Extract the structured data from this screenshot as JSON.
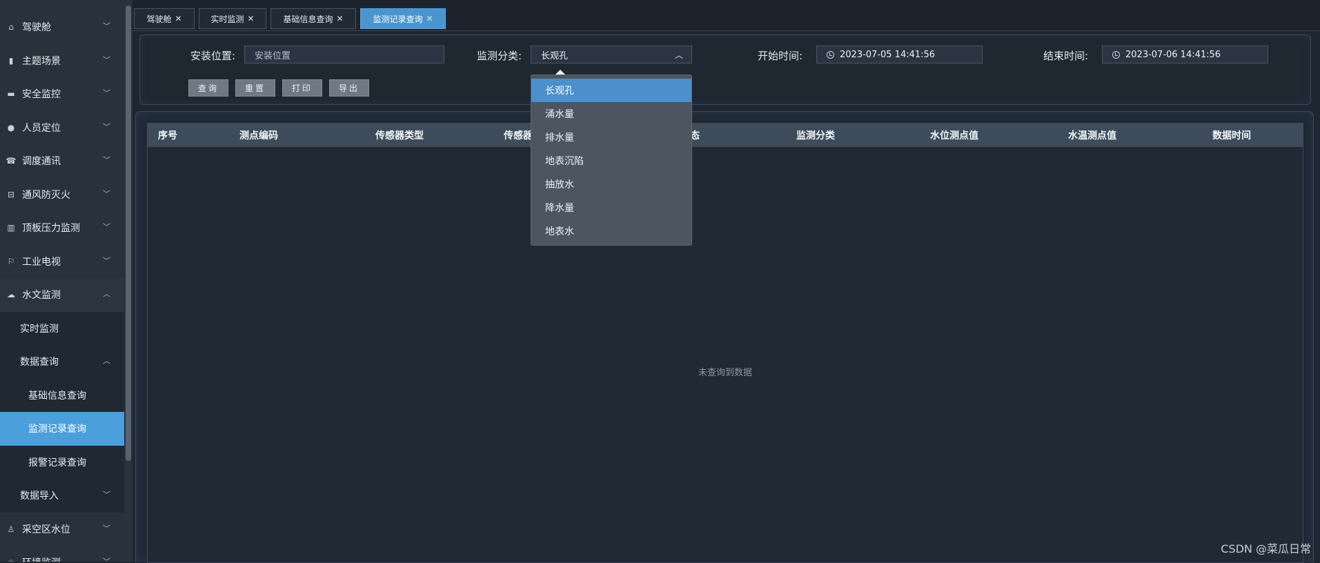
{
  "sidebar": {
    "items": [
      {
        "label": "驾驶舱",
        "icon": "home-icon"
      },
      {
        "label": "主题场景",
        "icon": "book-icon"
      },
      {
        "label": "安全监控",
        "icon": "monitor-icon"
      },
      {
        "label": "人员定位",
        "icon": "user-icon"
      },
      {
        "label": "调度通讯",
        "icon": "phone-icon"
      },
      {
        "label": "通风防灭火",
        "icon": "fan-icon"
      },
      {
        "label": "顶板压力监测",
        "icon": "bar-chart-icon"
      },
      {
        "label": "工业电视",
        "icon": "flag-icon"
      },
      {
        "label": "水文监测",
        "icon": "cloud-icon"
      }
    ],
    "sub": {
      "realtime": "实时监测",
      "data_query": "数据查询",
      "basic_info": "基础信息查询",
      "monitor_record": "监测记录查询",
      "alarm_record": "报警记录查询",
      "data_import": "数据导入"
    },
    "after": [
      {
        "label": "采空区水位",
        "icon": "person-icon"
      },
      {
        "label": "环境监测",
        "icon": "star-icon"
      }
    ]
  },
  "tabs": [
    {
      "label": "驾驶舱"
    },
    {
      "label": "实时监测"
    },
    {
      "label": "基础信息查询"
    },
    {
      "label": "监测记录查询"
    }
  ],
  "query": {
    "location_label": "安装位置:",
    "location_placeholder": "安装位置",
    "category_label": "监测分类:",
    "category_value": "长观孔",
    "start_label": "开始时间:",
    "start_value": "2023-07-05 14:41:56",
    "end_label": "结束时间:",
    "end_value": "2023-07-06 14:41:56",
    "buttons": {
      "search": "查询",
      "reset": "重置",
      "print": "打印",
      "export": "导出"
    }
  },
  "dropdown": {
    "options": [
      "长观孔",
      "涌水量",
      "排水量",
      "地表沉陷",
      "抽放水",
      "降水量",
      "地表水"
    ],
    "selected": "长观孔"
  },
  "table": {
    "headers": [
      "序号",
      "测点编码",
      "传感器类型",
      "传感器",
      "态",
      "监测分类",
      "水位测点值",
      "水温测点值",
      "数据时间"
    ],
    "empty_text": "未查询到数据"
  },
  "watermark": "CSDN @菜瓜日常"
}
